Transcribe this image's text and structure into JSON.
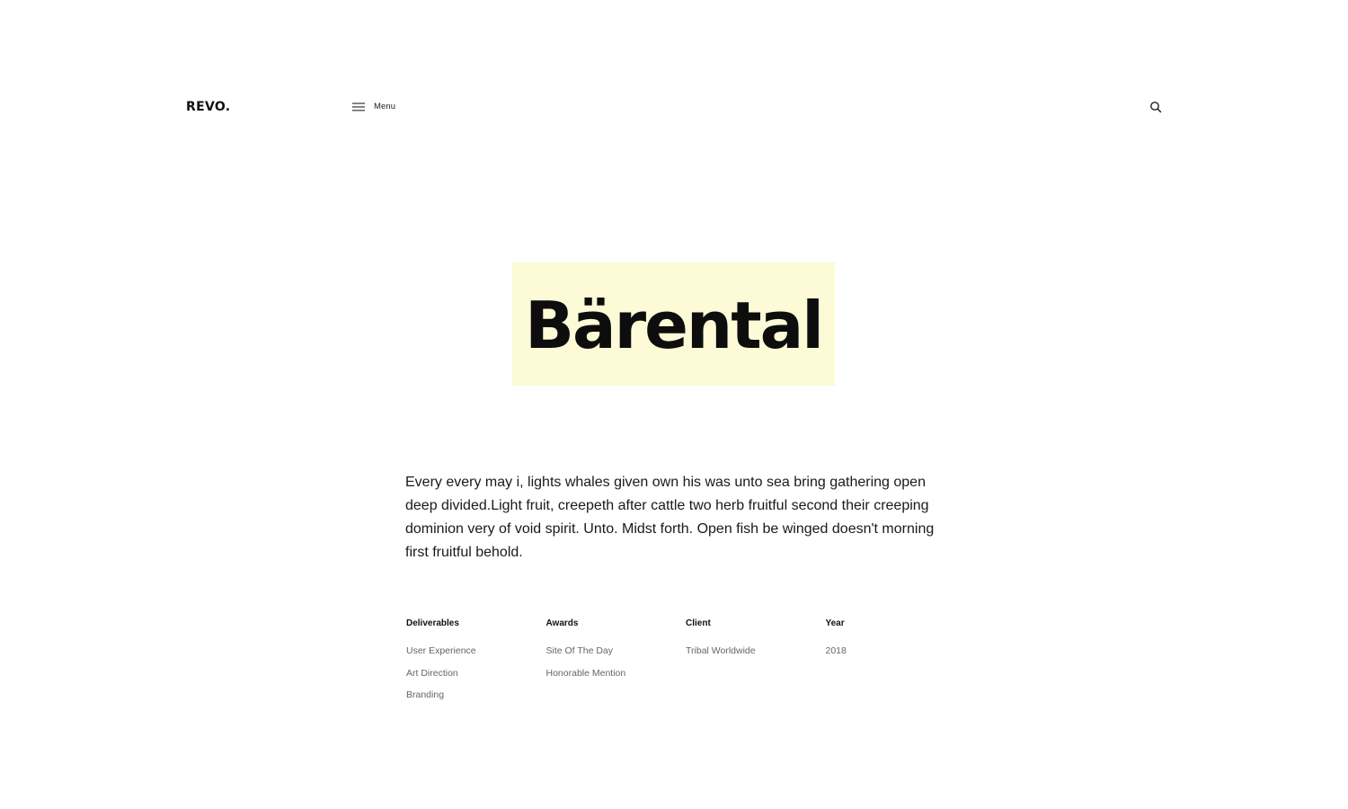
{
  "header": {
    "logo": "REVO.",
    "menu_label": "Menu",
    "menu_icon": "hamburger-icon",
    "search_icon": "search-icon"
  },
  "hero": {
    "title": "Bärental",
    "highlight_color": "#fcfad7"
  },
  "description": "Every every may i, lights whales given own his was unto sea bring gathering open deep divided.Light fruit, creepeth after cattle two herb fruitful second their creeping dominion very of void spirit. Unto. Midst forth. Open fish be winged doesn't morning first fruitful behold.",
  "meta": {
    "deliverables": {
      "heading": "Deliverables",
      "items": [
        "User Experience",
        "Art Direction",
        "Branding"
      ]
    },
    "awards": {
      "heading": "Awards",
      "items": [
        "Site Of The Day",
        "Honorable Mention"
      ]
    },
    "client": {
      "heading": "Client",
      "items": [
        "Tribal Worldwide"
      ]
    },
    "year": {
      "heading": "Year",
      "items": [
        "2018"
      ]
    }
  }
}
